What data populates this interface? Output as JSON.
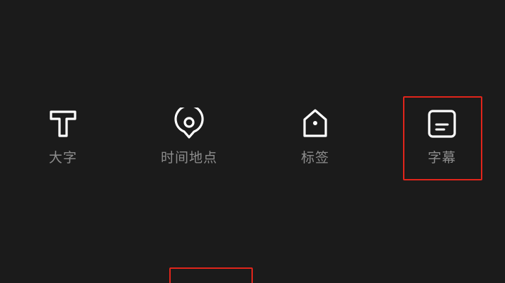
{
  "tools": [
    {
      "id": "text-big",
      "label": "大字",
      "icon": "big-text-icon"
    },
    {
      "id": "time-location",
      "label": "时间地点",
      "icon": "location-pin-icon"
    },
    {
      "id": "tag",
      "label": "标签",
      "icon": "tag-icon"
    },
    {
      "id": "subtitle",
      "label": "字幕",
      "icon": "subtitle-icon"
    }
  ],
  "colors": {
    "background": "#1b1b1b",
    "icon": "#ffffff",
    "label": "#8d8d8d",
    "highlight": "#e1251b"
  }
}
